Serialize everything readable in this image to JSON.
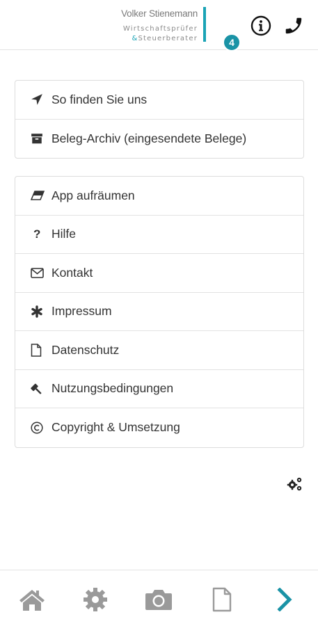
{
  "header": {
    "logo_name": "Volker Stienemann",
    "logo_line1": "Wirtschaftsprüfer",
    "logo_amp": "&",
    "logo_line2": "Steuerberater",
    "brand_color": "#1aa3b5",
    "info_icon": "info-circle-icon",
    "phone_icon": "phone-icon"
  },
  "menu_group_1": [
    {
      "label": "So finden Sie uns",
      "icon": "location-arrow-icon"
    },
    {
      "label": "Beleg-Archiv (eingesendete Belege)",
      "icon": "archive-icon"
    }
  ],
  "menu_group_2": [
    {
      "label": "App aufräumen",
      "icon": "eraser-icon"
    },
    {
      "label": "Hilfe",
      "icon": "question-icon"
    },
    {
      "label": "Kontakt",
      "icon": "envelope-icon"
    },
    {
      "label": "Impressum",
      "icon": "asterisk-icon"
    },
    {
      "label": "Datenschutz",
      "icon": "file-icon"
    },
    {
      "label": "Nutzungsbedingungen",
      "icon": "gavel-icon"
    },
    {
      "label": "Copyright & Umsetzung",
      "icon": "copyright-icon"
    }
  ],
  "settings_toggle_icon": "cogs-icon",
  "tabbar": {
    "items": [
      {
        "icon": "home-icon"
      },
      {
        "icon": "gear-icon"
      },
      {
        "icon": "camera-icon"
      },
      {
        "icon": "document-icon"
      },
      {
        "icon": "chevron-right-icon"
      }
    ],
    "docs_badge": "4",
    "inactive_color": "#9a9a9a",
    "accent_color": "#1a93a6"
  }
}
